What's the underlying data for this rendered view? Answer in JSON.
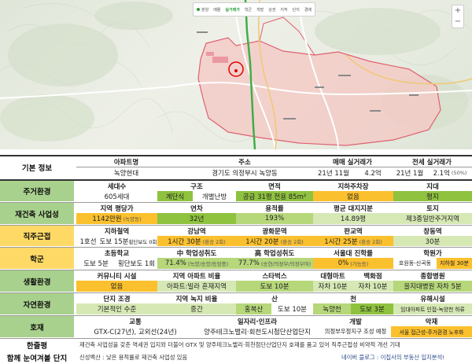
{
  "map": {
    "toolbar": [
      "분양",
      "매물",
      "실거래가",
      "학군",
      "개발",
      "상권",
      "지적",
      "단지",
      "경매"
    ],
    "zoom": [
      "+",
      "−"
    ]
  },
  "basic": {
    "section": "기본 정보",
    "apt_label": "아파트명",
    "apt_value": "녹양현대",
    "addr_label": "주소",
    "addr_value": "경기도 의정부시 녹양동",
    "sale_label": "매매 실거래가",
    "sale_date": "21년 11월",
    "sale_price": "4.2억",
    "jeonse_label": "전세 실거래가",
    "jeonse_date": "21년 1월",
    "jeonse_price": "2.1억",
    "jeonse_ratio": "(50%)"
  },
  "living": {
    "section": "주거환경",
    "h1": "세대수",
    "v1": "605세대",
    "h2": "구조",
    "v2a": "계단식",
    "v2b": "개별난방",
    "h3": "면적",
    "v3": "공급 31평  전용 85m²",
    "h4": "지하주차장",
    "v4": "없음",
    "h5": "지대",
    "v5": "평지"
  },
  "rebuild": {
    "section": "재건축 사업성",
    "h1": "지역 평당가",
    "v1": "1142만원",
    "v1note": "(녹양동)",
    "h2": "연차",
    "v2": "32년",
    "h3": "용적률",
    "v3": "193%",
    "h4": "평균 대지지분",
    "v4": "14.89평",
    "h5": "토지",
    "v5": "제3종일반주거지역"
  },
  "commute": {
    "section": "직주근접",
    "h1": "지하철역",
    "v1a": "1호선",
    "v1b": "도보 15분",
    "v1c": "횡단보도 0회",
    "h2": "강남역",
    "v2": "1시간 30분",
    "v2note": "(환승 2회)",
    "h3": "광화문역",
    "v3": "1시간 20분",
    "v3note": "(환승 2회)",
    "h4": "판교역",
    "v4": "1시간 25분",
    "v4note": "(환승 2회)",
    "h5": "창동역",
    "v5": "30분"
  },
  "school": {
    "section": "학군",
    "h1": "초등학교",
    "v1a": "도보 5분",
    "v1b": "횡단보도 1회",
    "h2": "中 학업성취도",
    "v2": "71.4%",
    "v2note": "(녹양/송양/동암중)",
    "h3": "高 학업성취도",
    "v3": "77.7%",
    "v3note": "(송현/의정부/의정부여)",
    "h4": "서울대 진학률",
    "v4": "0%",
    "v4note": "(가능동)",
    "h5": "학원가",
    "v5a": "호원동-신곡동",
    "v5b": "지하철 30분"
  },
  "life": {
    "section": "생활환경",
    "h1": "커뮤니티 시설",
    "v1": "없음",
    "h2": "지역 아파트 비율",
    "v2": "아파트:빌라 혼재지역",
    "h3": "스타벅스",
    "v3": "도보 10분",
    "h4a": "대형마트",
    "v4a": "자차 10분",
    "h4b": "백화점",
    "v4b": "자차 10분",
    "h5": "종합병원",
    "v5": "을지대병원  자차 5분"
  },
  "nature": {
    "section": "자연환경",
    "h1": "단지 조경",
    "v1": "기본적인 수준",
    "h2": "지역 녹지 비율",
    "v2": "중간",
    "h3": "산",
    "v3a": "홍복산",
    "v3b": "도보 10분",
    "h4": "천",
    "v4a": "녹양천",
    "v4b": "도보 3분",
    "h5": "유해시설",
    "v5": "임대아파트 인접-녹양천 하류"
  },
  "good": {
    "section": "호재",
    "h1": "교통",
    "v1": "GTX-C(27년), 교외선(24년)",
    "h2": "일자리·인프라",
    "v2": "양주테크노밸리·회천도시첨단산업단지",
    "h3": "개발",
    "v3": "의정부우정지구 조성 예정",
    "h4": "악재",
    "v4": "서울 접근성-주거환경 노후화"
  },
  "notes": {
    "summary_label": "한줄평",
    "summary_text": "재건축 사업성을 갖춘 역세권 입지와 더불어 GTX 및 양주테크노밸리·회천첨단산업단지 호재를 품고 있어 직주근접성 비약적 개선 기대",
    "compare_label": "함께 눈여겨볼 단지",
    "compare_text": "신성백산 : 낮은 용적률로 재건축 사업성 있음",
    "blog_text": "네이버 블로그 : 이집사의 부동산 입지분석!"
  }
}
